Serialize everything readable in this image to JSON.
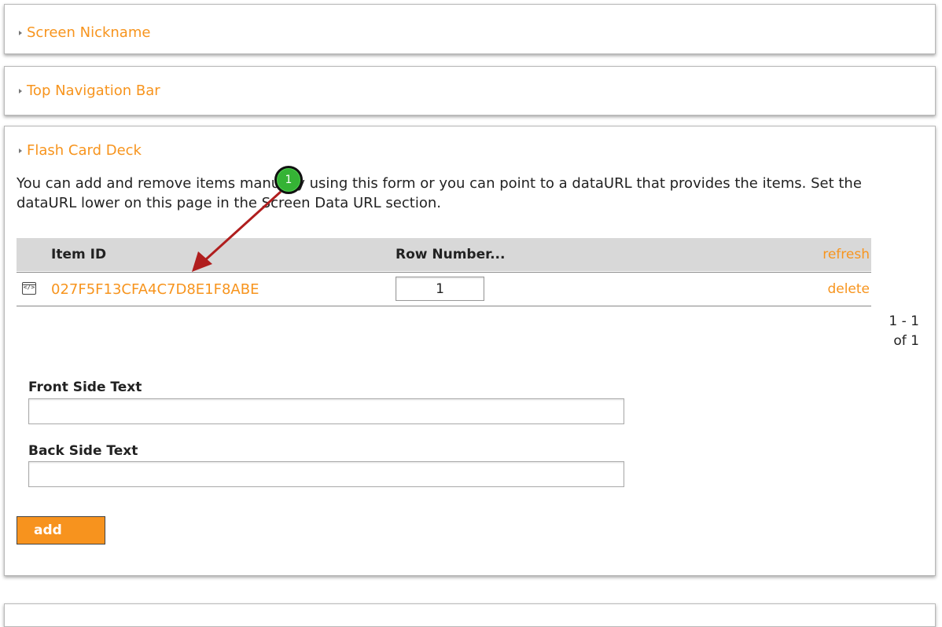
{
  "sections": {
    "nickname": {
      "title": "Screen Nickname"
    },
    "top_nav": {
      "title": "Top Navigation Bar"
    },
    "flash_card": {
      "title": "Flash Card Deck",
      "description": "You can add and remove items manually using this form or you can point to a dataURL that provides the items. Set the dataURL lower on this page in the Screen Data URL section.",
      "grid": {
        "col_item_id": "Item ID",
        "col_row_number": "Row Number...",
        "refresh_label": "refresh",
        "rows": [
          {
            "item_id": "027F5F13CFA4C7D8E1F8ABE",
            "row_number": "1",
            "delete_label": "delete"
          }
        ],
        "pager_line1": "1 - 1",
        "pager_line2": "of 1"
      },
      "front_label": "Front Side Text",
      "front_value": "",
      "back_label": "Back Side Text",
      "back_value": "",
      "add_label": "add"
    }
  },
  "callout": {
    "number": "1",
    "color": "#35b335",
    "arrow_color": "#b01e1e"
  },
  "colors": {
    "accent": "#f7941d"
  },
  "icons": {
    "row_icon": "code-window-icon",
    "section_caret": "caret-right-icon"
  }
}
